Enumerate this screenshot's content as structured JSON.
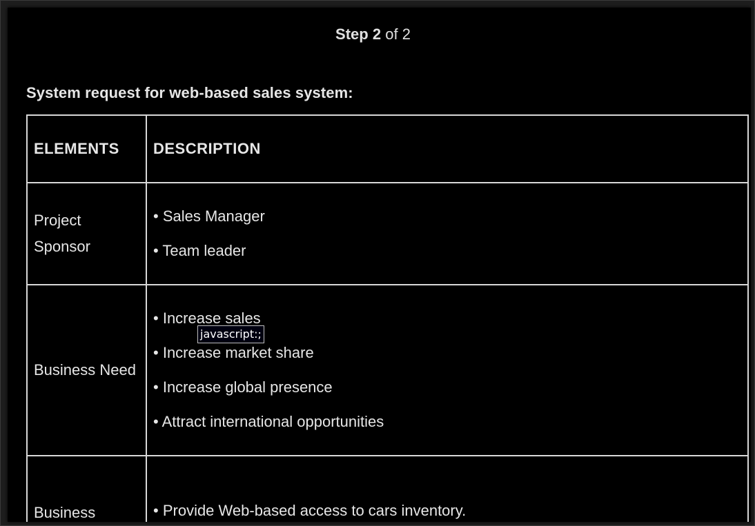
{
  "step": {
    "label": "Step",
    "current": "2",
    "of_text": "of 2"
  },
  "heading": "System request for web-based sales system:",
  "table": {
    "headers": [
      "ELEMENTS",
      "DESCRIPTION"
    ],
    "rows": [
      {
        "element": "Project Sponsor",
        "items": [
          "Sales Manager",
          "Team leader"
        ]
      },
      {
        "element": "Business Need",
        "items": [
          "Increase sales",
          "Increase market share",
          "Increase global presence",
          "Attract international opportunities"
        ]
      },
      {
        "element": "Business",
        "items": [
          "Provide Web-based access to cars inventory."
        ]
      }
    ]
  },
  "tooltip": "javascript:;"
}
